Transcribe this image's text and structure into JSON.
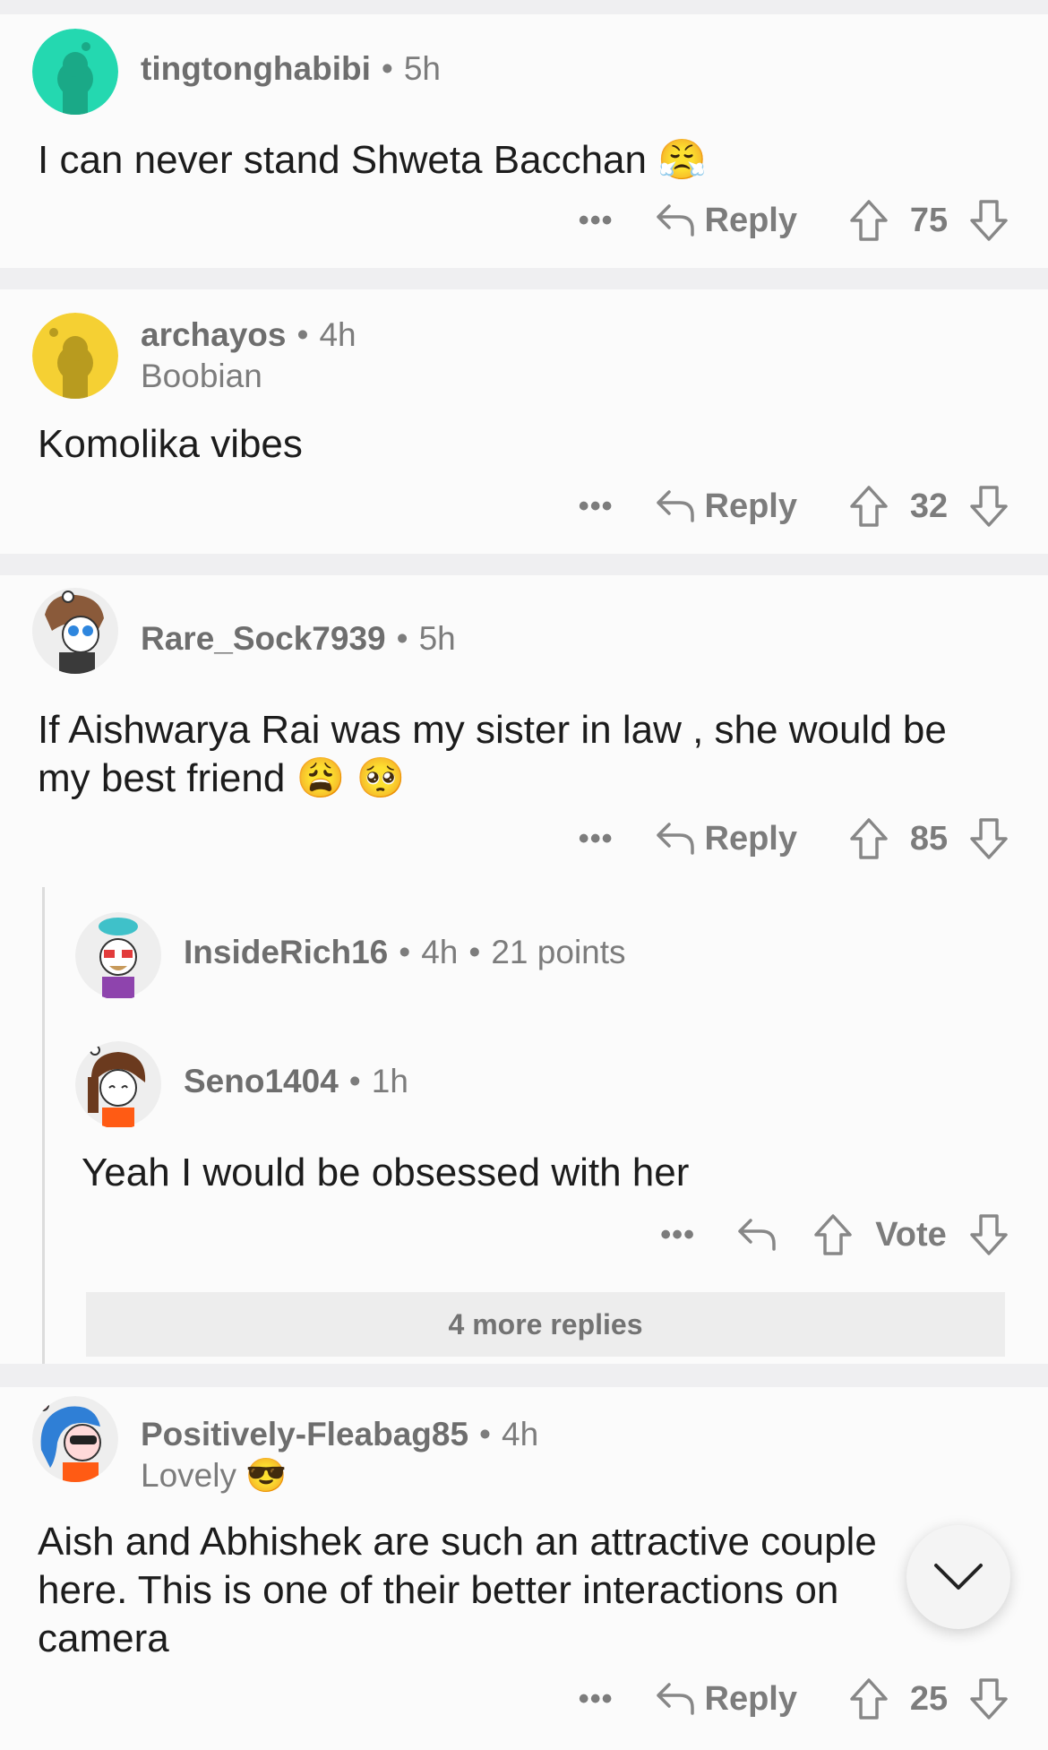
{
  "comments": [
    {
      "user": "tingtonghabibi",
      "time": "5h",
      "body": "I can never stand Shweta Bacchan 😤",
      "reply_label": "Reply",
      "votes": "75",
      "avatar_color": "#24d8b0"
    },
    {
      "user": "archayos",
      "time": "4h",
      "flair": "Boobian",
      "body": "Komolika vibes",
      "reply_label": "Reply",
      "votes": "32",
      "avatar_color": "#f5d033"
    },
    {
      "user": "Rare_Sock7939",
      "time": "5h",
      "body_line1": "If Aishwarya Rai was my sister in law , she would be",
      "body_line2": "my best friend 😩 🥺",
      "reply_label": "Reply",
      "votes": "85"
    },
    {
      "user": "Positively-Fleabag85",
      "time": "4h",
      "flair": "Lovely 😎",
      "body_line1": "Aish and Abhishek are such an attractive couple",
      "body_line2": "here. This is one of their better interactions on",
      "body_line3": "camera",
      "reply_label": "Reply",
      "votes": "25"
    }
  ],
  "replies": [
    {
      "user": "InsideRich16",
      "time": "4h",
      "points": "21 points"
    },
    {
      "user": "Seno1404",
      "time": "1h",
      "body": "Yeah I would be obsessed with her",
      "vote_label": "Vote"
    }
  ],
  "more_replies": "4 more replies",
  "separator": "•",
  "dots": "•••",
  "icons": [
    "reply-arrow-icon",
    "upvote-arrow-icon",
    "downvote-arrow-icon",
    "chevron-down-icon"
  ]
}
